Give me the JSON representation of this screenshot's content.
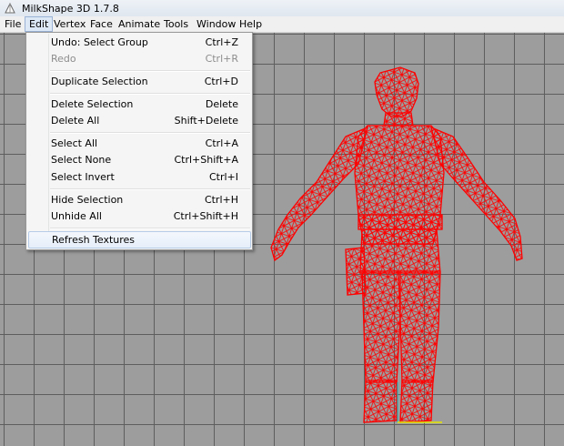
{
  "window": {
    "title": "MilkShape 3D 1.7.8"
  },
  "menubar": {
    "items": [
      "File",
      "Edit",
      "Vertex",
      "Face",
      "Animate",
      "Tools",
      "Window",
      "Help"
    ]
  },
  "edit_menu": {
    "items": [
      {
        "label": "Undo: Select Group",
        "shortcut": "Ctrl+Z",
        "enabled": true
      },
      {
        "label": "Redo",
        "shortcut": "Ctrl+R",
        "enabled": false
      },
      {
        "label": "Duplicate Selection",
        "shortcut": "Ctrl+D",
        "enabled": true
      },
      {
        "label": "Delete Selection",
        "shortcut": "Delete",
        "enabled": true
      },
      {
        "label": "Delete All",
        "shortcut": "Shift+Delete",
        "enabled": true
      },
      {
        "label": "Select All",
        "shortcut": "Ctrl+A",
        "enabled": true
      },
      {
        "label": "Select None",
        "shortcut": "Ctrl+Shift+A",
        "enabled": true
      },
      {
        "label": "Select Invert",
        "shortcut": "Ctrl+I",
        "enabled": true
      },
      {
        "label": "Hide Selection",
        "shortcut": "Ctrl+H",
        "enabled": true
      },
      {
        "label": "Unhide All",
        "shortcut": "Ctrl+Shift+H",
        "enabled": true
      },
      {
        "label": "Refresh Textures",
        "shortcut": "",
        "enabled": true,
        "highlighted": true
      }
    ]
  },
  "viewport": {
    "background_color": "#9d9d9d",
    "grid_color": "#5e5e5e",
    "model_wire_color": "#ff0000",
    "axis_y_color": "#00cccc",
    "axis_x_color": "#e6e600"
  }
}
